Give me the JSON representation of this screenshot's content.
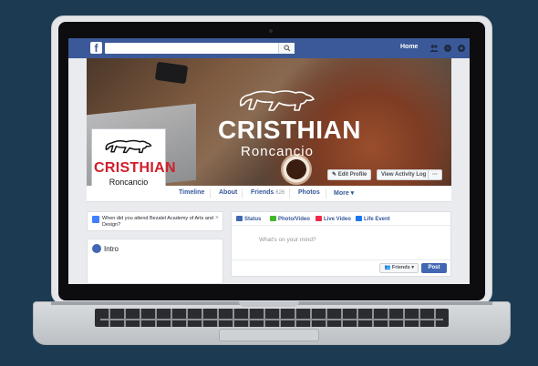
{
  "header": {
    "logo_letter": "f",
    "search_placeholder": "",
    "home_label": "Home"
  },
  "cover": {
    "logo_name": "CRISTHIAN",
    "logo_surname": "Roncancio",
    "edit_profile_label": "Edit Profile",
    "activity_log_label": "View Activity Log",
    "more_label": "···"
  },
  "profile_picture": {
    "name": "CRISTHIAN",
    "surname": "Roncancio"
  },
  "tabs": {
    "timeline": "Timeline",
    "about": "About",
    "friends": "Friends",
    "friends_count": "626",
    "photos": "Photos",
    "more": "More ▾"
  },
  "sidebar": {
    "prompt_text": "When did you attend Bezalel Academy of Arts and Design?",
    "prompt_close": "×",
    "intro_title": "Intro"
  },
  "composer": {
    "tabs": [
      "Status",
      "Photo/Video",
      "Live Video",
      "Life Event"
    ],
    "placeholder": "What's on your mind?",
    "audience_label": "Friends ▾",
    "post_label": "Post"
  },
  "colors": {
    "facebook_blue": "#3b5998",
    "link_blue": "#365899",
    "brand_red": "#d0202a",
    "background": "#1c3b52"
  }
}
